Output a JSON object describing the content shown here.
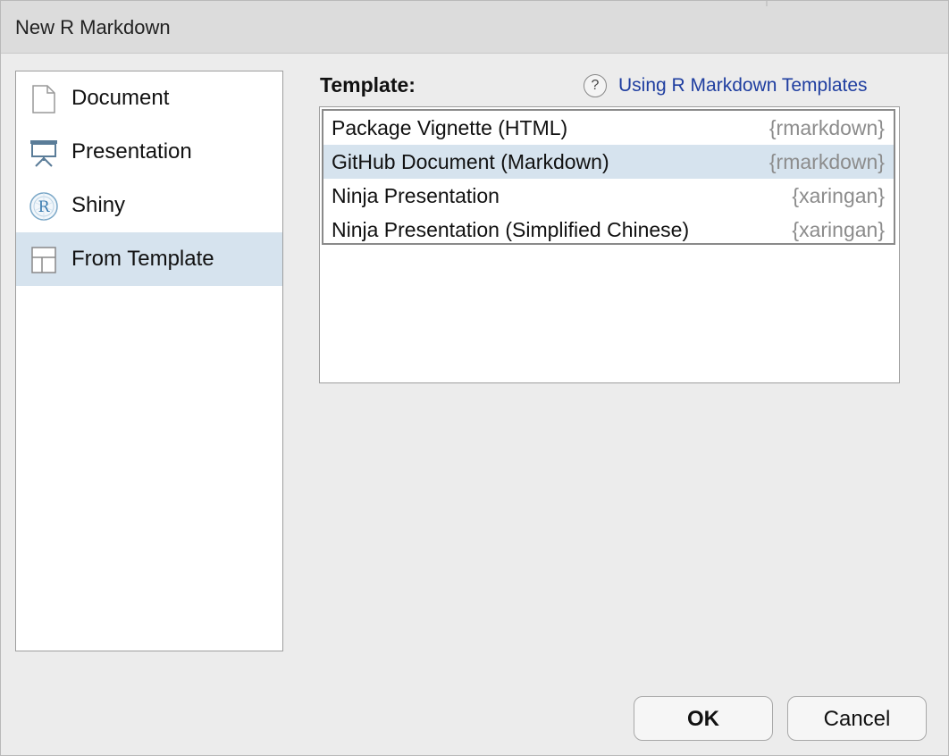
{
  "window": {
    "title": "New R Markdown"
  },
  "types": [
    {
      "label": "Document",
      "icon": "document-icon",
      "selected": false
    },
    {
      "label": "Presentation",
      "icon": "presentation-icon",
      "selected": false
    },
    {
      "label": "Shiny",
      "icon": "shiny-r-icon",
      "selected": false
    },
    {
      "label": "From Template",
      "icon": "template-icon",
      "selected": true
    }
  ],
  "template_panel": {
    "label": "Template:",
    "help_icon": "?",
    "help_link": "Using R Markdown Templates",
    "templates": [
      {
        "name": "Package Vignette (HTML)",
        "package": "{rmarkdown}",
        "selected": false
      },
      {
        "name": "GitHub Document (Markdown)",
        "package": "{rmarkdown}",
        "selected": true
      },
      {
        "name": "Ninja Presentation",
        "package": "{xaringan}",
        "selected": false
      },
      {
        "name": "Ninja Presentation (Simplified Chinese)",
        "package": "{xaringan}",
        "selected": false
      }
    ]
  },
  "buttons": {
    "ok": "OK",
    "cancel": "Cancel"
  },
  "colors": {
    "selection": "#d6e3ee",
    "link": "#1f3ea0",
    "package_text": "#8c8c8c"
  }
}
